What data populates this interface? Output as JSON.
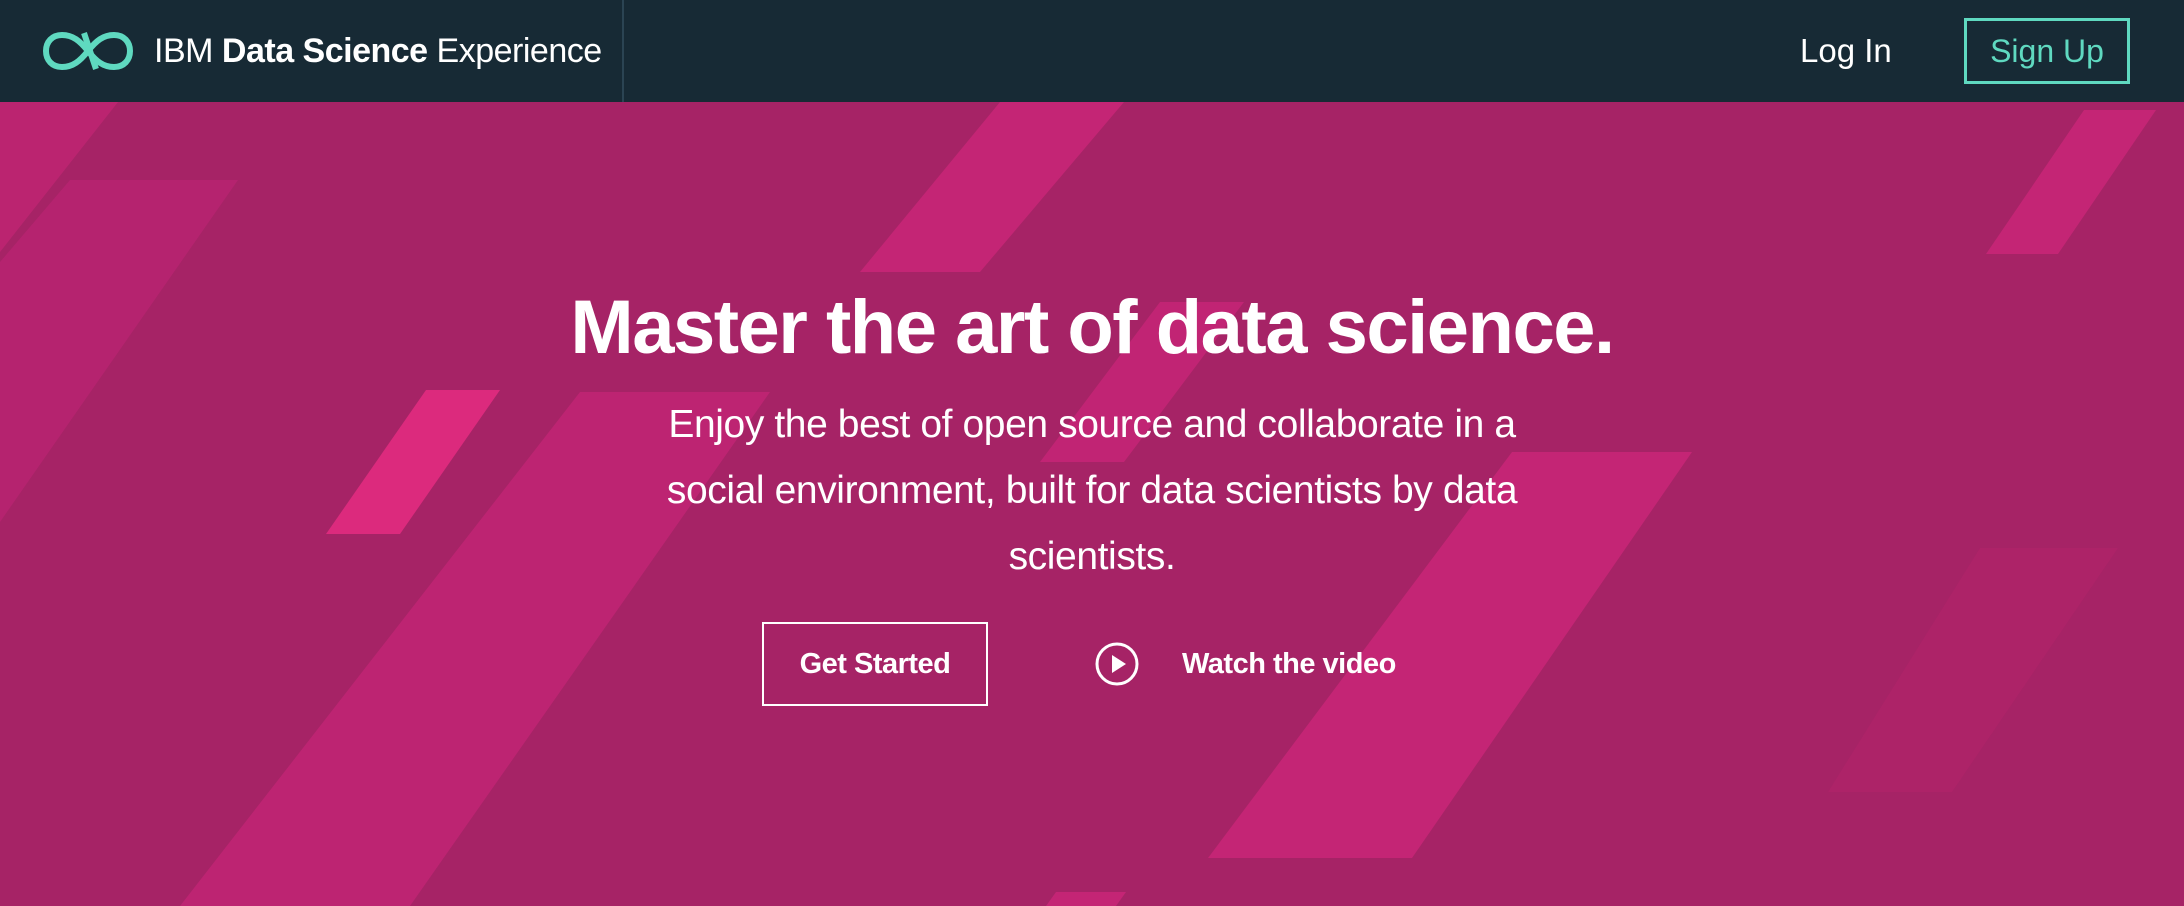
{
  "header": {
    "brand": {
      "prefix": "IBM",
      "bold": "Data Science",
      "suffix": "Experience",
      "logo_icon": "infinity-icon"
    },
    "login_label": "Log In",
    "signup_label": "Sign Up"
  },
  "hero": {
    "title": "Master the art of data science.",
    "subtitle": "Enjoy the best of open source and collaborate in a social environment, built for data scientists by data scientists.",
    "get_started_label": "Get Started",
    "watch_video_label": "Watch the video",
    "play_icon": "play-circle-icon"
  },
  "colors": {
    "header_bg": "#172a35",
    "hero_bg": "#a62366",
    "accent_teal": "#5fd9c0",
    "stripe_pink": "#c42575",
    "stripe_bright": "#dc2a7d"
  }
}
